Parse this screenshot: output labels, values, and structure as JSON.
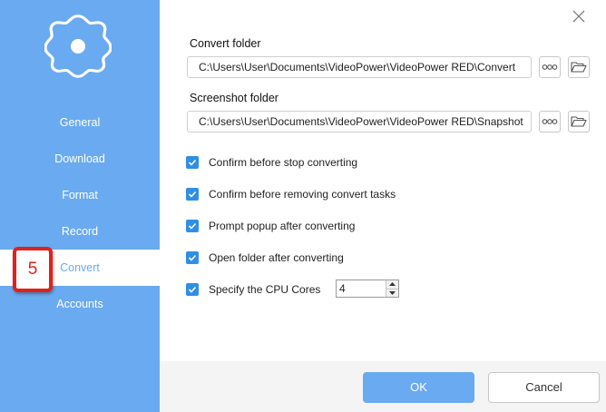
{
  "sidebar": {
    "items": [
      {
        "label": "General"
      },
      {
        "label": "Download"
      },
      {
        "label": "Format"
      },
      {
        "label": "Record"
      },
      {
        "label": "Convert"
      },
      {
        "label": "Accounts"
      }
    ],
    "active": "Convert"
  },
  "annotation": {
    "step": "5"
  },
  "convert_folder": {
    "label": "Convert folder",
    "value": "C:\\Users\\User\\Documents\\VideoPower\\VideoPower RED\\Convert"
  },
  "screenshot_folder": {
    "label": "Screenshot folder",
    "value": "C:\\Users\\User\\Documents\\VideoPower\\VideoPower RED\\Snapshot"
  },
  "options": [
    {
      "label": "Confirm before stop converting",
      "checked": true
    },
    {
      "label": "Confirm before removing convert tasks",
      "checked": true
    },
    {
      "label": "Prompt popup after converting",
      "checked": true
    },
    {
      "label": "Open folder after converting",
      "checked": true
    },
    {
      "label": "Specify the CPU Cores",
      "checked": true
    }
  ],
  "cpu_cores": {
    "value": "4"
  },
  "buttons": {
    "ok": "OK",
    "cancel": "Cancel"
  },
  "colors": {
    "accent": "#6aaaf0",
    "checkbox": "#2f8ee6",
    "badge": "#e0211c"
  },
  "icons": {
    "settings": "gear-icon",
    "close": "close-icon",
    "browse": "more-dots-icon",
    "open": "folder-open-icon"
  }
}
